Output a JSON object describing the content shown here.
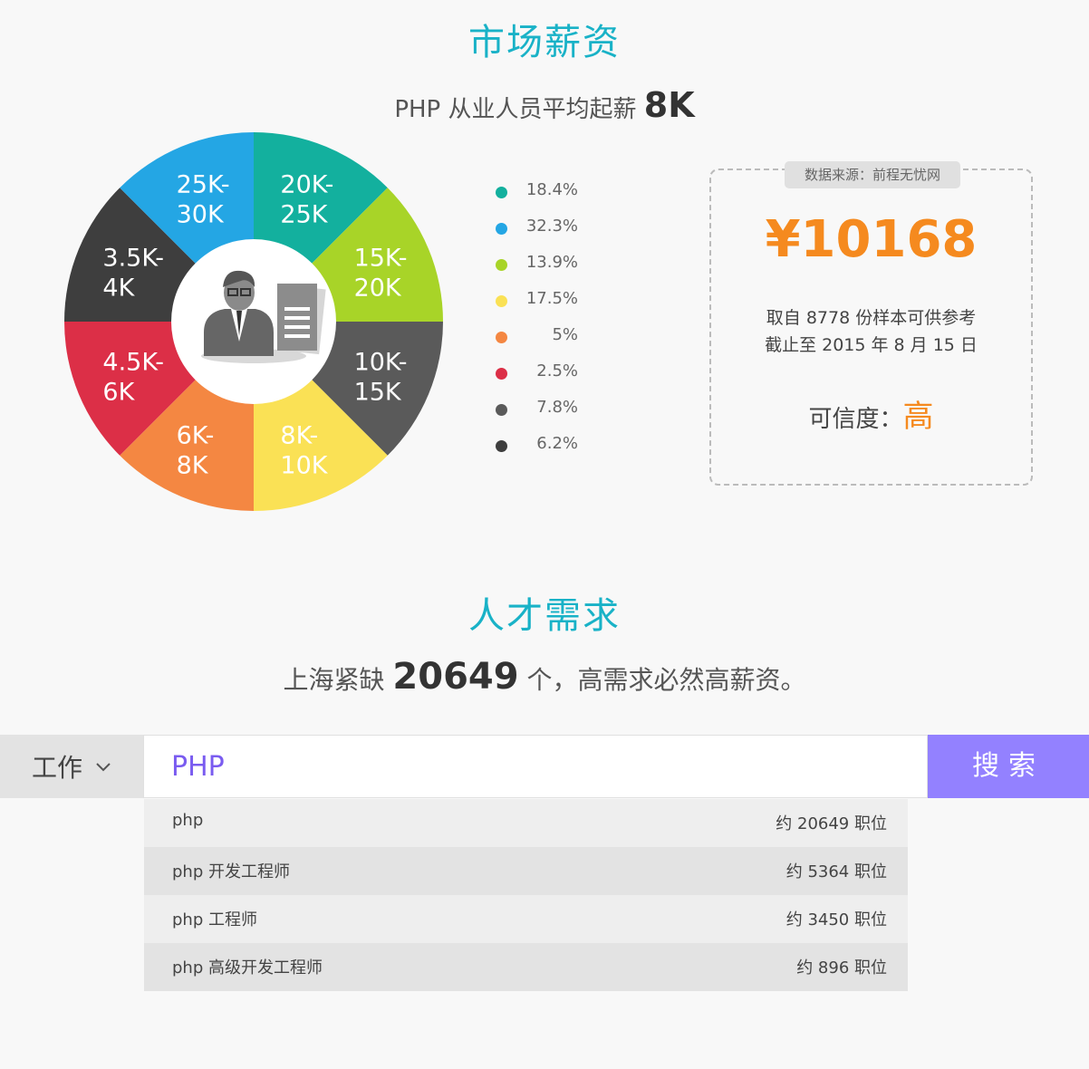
{
  "market": {
    "title": "市场薪资",
    "subtitle_prefix": "PHP 从业人员平均起薪",
    "subtitle_value": "8K"
  },
  "chart_data": {
    "type": "pie",
    "slices": [
      {
        "label": "20K-\n25K",
        "color": "#13b09e"
      },
      {
        "label": "15K-\n20K",
        "color": "#a8d428"
      },
      {
        "label": "10K-\n15K",
        "color": "#5a5a5a"
      },
      {
        "label": "8K-\n10K",
        "color": "#fae155"
      },
      {
        "label": "6K-\n8K",
        "color": "#f48742"
      },
      {
        "label": "4.5K-\n6K",
        "color": "#dc2f47"
      },
      {
        "label": "3.5K-\n4K",
        "color": "#3e3e3e"
      },
      {
        "label": "25K-\n30K",
        "color": "#24a6e4"
      }
    ],
    "legend": [
      {
        "value": "18.4%",
        "color": "#13b09e"
      },
      {
        "value": "32.3%",
        "color": "#24a6e4"
      },
      {
        "value": "13.9%",
        "color": "#a8d428"
      },
      {
        "value": "17.5%",
        "color": "#fae155"
      },
      {
        "value": "5%",
        "color": "#f48742"
      },
      {
        "value": "2.5%",
        "color": "#dc2f47"
      },
      {
        "value": "7.8%",
        "color": "#5a5a5a"
      },
      {
        "value": "6.2%",
        "color": "#3e3e3e"
      }
    ]
  },
  "info": {
    "source": "数据来源：前程无忧网",
    "salary": "¥10168",
    "sample_line1": "取自 8778 份样本可供参考",
    "sample_line2": "截止至 2015 年 8 月 15 日",
    "credibility_label": "可信度：",
    "credibility_value": "高"
  },
  "demand": {
    "title": "人才需求",
    "prefix": "上海紧缺",
    "count": "20649",
    "suffix": "个，高需求必然高薪资。"
  },
  "search": {
    "type_label": "工作",
    "input_value": "PHP",
    "button_label": "搜索",
    "suggestions": [
      {
        "term": "php",
        "count": "约 20649 职位"
      },
      {
        "term": "php 开发工程师",
        "count": "约 5364 职位"
      },
      {
        "term": "php 工程师",
        "count": "约 3450 职位"
      },
      {
        "term": "php 高级开发工程师",
        "count": "约 896 职位"
      }
    ]
  },
  "colors": {
    "accent_title": "#19b2c7",
    "salary": "#f58a1f",
    "search_button": "#9381ff",
    "input_text": "#7a5cf0"
  }
}
